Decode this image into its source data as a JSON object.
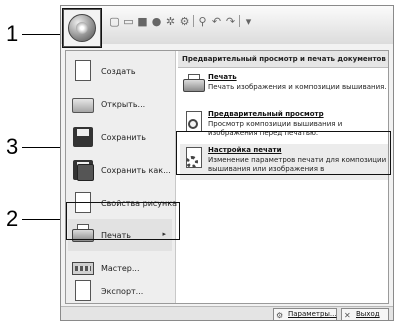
{
  "callouts": [
    "1",
    "2",
    "3"
  ],
  "left_menu": {
    "items": [
      {
        "label": "Создать",
        "icon": "new-document-icon"
      },
      {
        "label": "Открыть...",
        "icon": "open-folder-icon"
      },
      {
        "label": "Сохранить",
        "icon": "save-disk-icon"
      },
      {
        "label": "Сохранить как...",
        "icon": "save-as-icon"
      },
      {
        "label": "Свойства рисунка",
        "icon": "design-properties-icon"
      },
      {
        "label": "Печать",
        "icon": "printer-icon",
        "has_submenu": true
      },
      {
        "label": "Мастер...",
        "icon": "wizard-icon"
      },
      {
        "label": "Экспорт...",
        "icon": "export-icon"
      }
    ]
  },
  "submenu": {
    "header": "Предварительный просмотр и печать документов",
    "items": [
      {
        "title": "Печать",
        "description": "Печать изображения и композиции вышивания.",
        "icon": "printer-icon"
      },
      {
        "title": "Предварительный просмотр",
        "description": "Просмотр композиции вышивания и изображения перед печатью.",
        "icon": "preview-icon"
      },
      {
        "title": "Настройка печати",
        "description": "Изменение параметров печати для композиции вышивания или изображения в",
        "icon": "print-setup-icon"
      }
    ]
  },
  "status_bar": {
    "options_label": "Параметры...",
    "exit_label": "Выход"
  },
  "submenu_arrow": "▸"
}
